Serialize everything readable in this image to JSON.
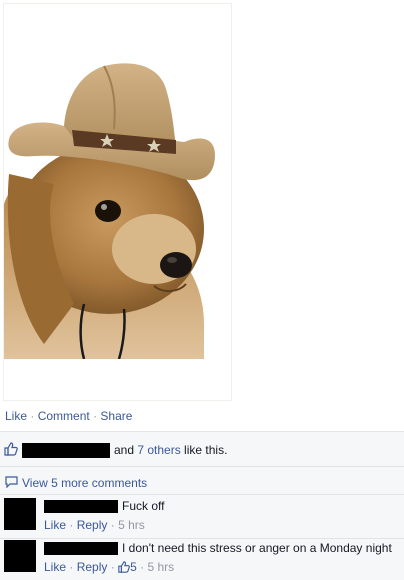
{
  "photo": {
    "description_icon": "dog-in-cowboy-hat"
  },
  "actions": {
    "like": "Like",
    "comment": "Comment",
    "share": "Share",
    "separator": "·"
  },
  "likes": {
    "text_before": "and ",
    "others_link": "7 others",
    "text_after": " like this."
  },
  "more_comments": {
    "label": "View 5 more comments"
  },
  "comments": [
    {
      "text": "Fuck off",
      "like": "Like",
      "reply": "Reply",
      "time": "5 hrs"
    },
    {
      "text": "I don't need this stress or anger on a Monday night",
      "like": "Like",
      "reply": "Reply",
      "like_count": "5",
      "time": "5 hrs"
    }
  ],
  "colors": {
    "link": "#3b5998",
    "muted": "#9197a3",
    "feedback_bg": "#f6f7f9"
  }
}
